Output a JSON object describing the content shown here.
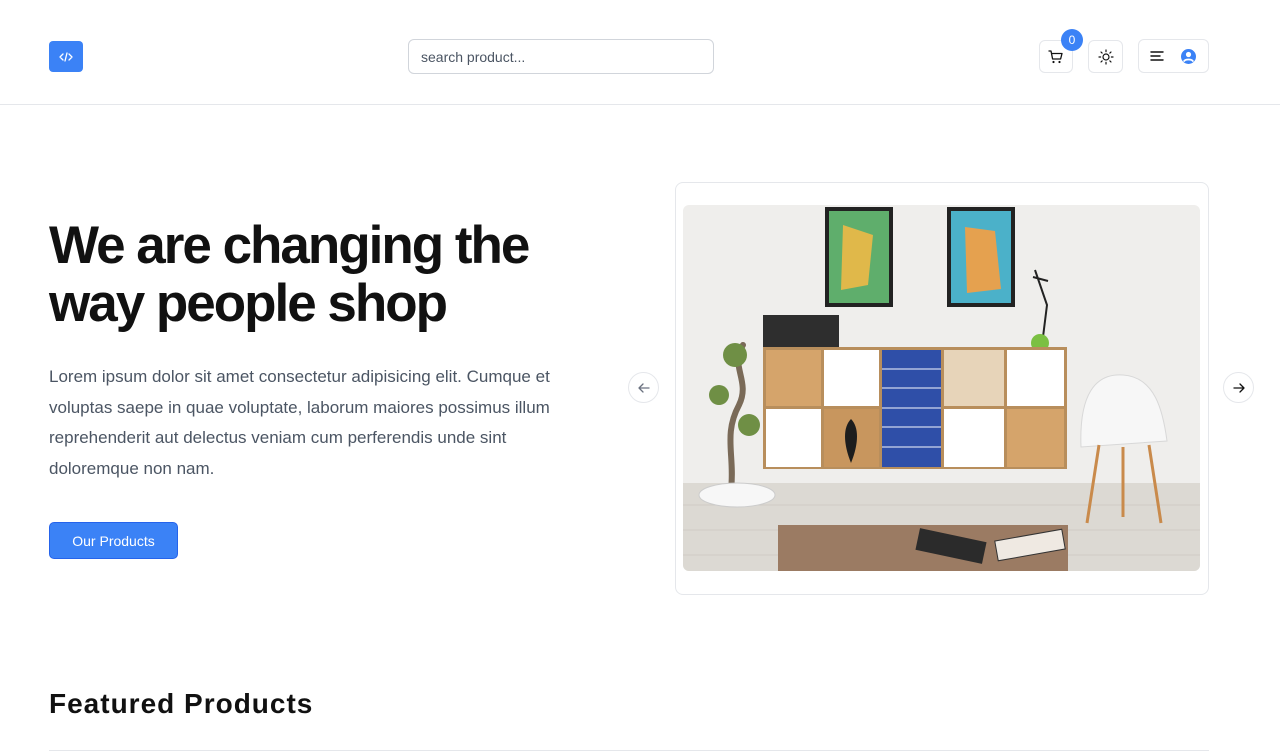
{
  "header": {
    "search_placeholder": "search product...",
    "cart_count": "0"
  },
  "hero": {
    "title_line1": "We are changing the",
    "title_line2": "way people shop",
    "description": "Lorem ipsum dolor sit amet consectetur adipisicing elit. Cumque et voluptas saepe in quae voluptate, laborum maiores possimus illum reprehenderit aut delectus veniam cum perferendis unde sint doloremque non nam.",
    "cta_label": "Our Products"
  },
  "featured": {
    "title": "Featured Products"
  },
  "icons": {
    "logo": "code-icon",
    "cart": "cart-icon",
    "theme": "sun-icon",
    "menu": "menu-icon",
    "user": "user-avatar-icon",
    "prev": "arrow-left-icon",
    "next": "arrow-right-icon"
  },
  "colors": {
    "accent": "#3b82f6",
    "text": "#111111",
    "muted": "#4b5563",
    "border": "#e5e7eb"
  }
}
